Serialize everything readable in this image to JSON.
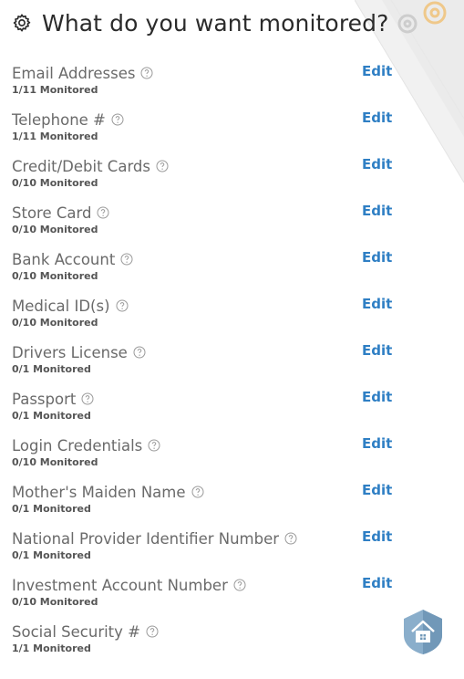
{
  "header": {
    "title": "What do you want monitored?",
    "icon": "gear-icon"
  },
  "edit_label": "Edit",
  "items": [
    {
      "label": "Email Addresses",
      "status": "1/11 Monitored",
      "editable": true
    },
    {
      "label": "Telephone #",
      "status": "1/11 Monitored",
      "editable": true
    },
    {
      "label": "Credit/Debit Cards",
      "status": "0/10 Monitored",
      "editable": true
    },
    {
      "label": "Store Card",
      "status": "0/10 Monitored",
      "editable": true
    },
    {
      "label": "Bank Account",
      "status": "0/10 Monitored",
      "editable": true
    },
    {
      "label": "Medical ID(s)",
      "status": "0/10 Monitored",
      "editable": true
    },
    {
      "label": "Drivers License",
      "status": "0/1 Monitored",
      "editable": true
    },
    {
      "label": "Passport",
      "status": "0/1 Monitored",
      "editable": true
    },
    {
      "label": "Login Credentials",
      "status": "0/10 Monitored",
      "editable": true
    },
    {
      "label": "Mother's Maiden Name",
      "status": "0/1 Monitored",
      "editable": true
    },
    {
      "label": "National Provider Identifier Number",
      "status": "0/1 Monitored",
      "editable": true
    },
    {
      "label": "Investment Account Number",
      "status": "0/10 Monitored",
      "editable": true
    },
    {
      "label": "Social Security #",
      "status": "1/1 Monitored",
      "editable": false
    }
  ],
  "colors": {
    "title": "#2b2b2b",
    "label": "#6a6a6a",
    "status": "#555555",
    "link": "#2f7fc4",
    "badge": "#7fa3bf"
  },
  "icons": {
    "help": "question-circle-icon",
    "badge": "house-shield-icon"
  }
}
